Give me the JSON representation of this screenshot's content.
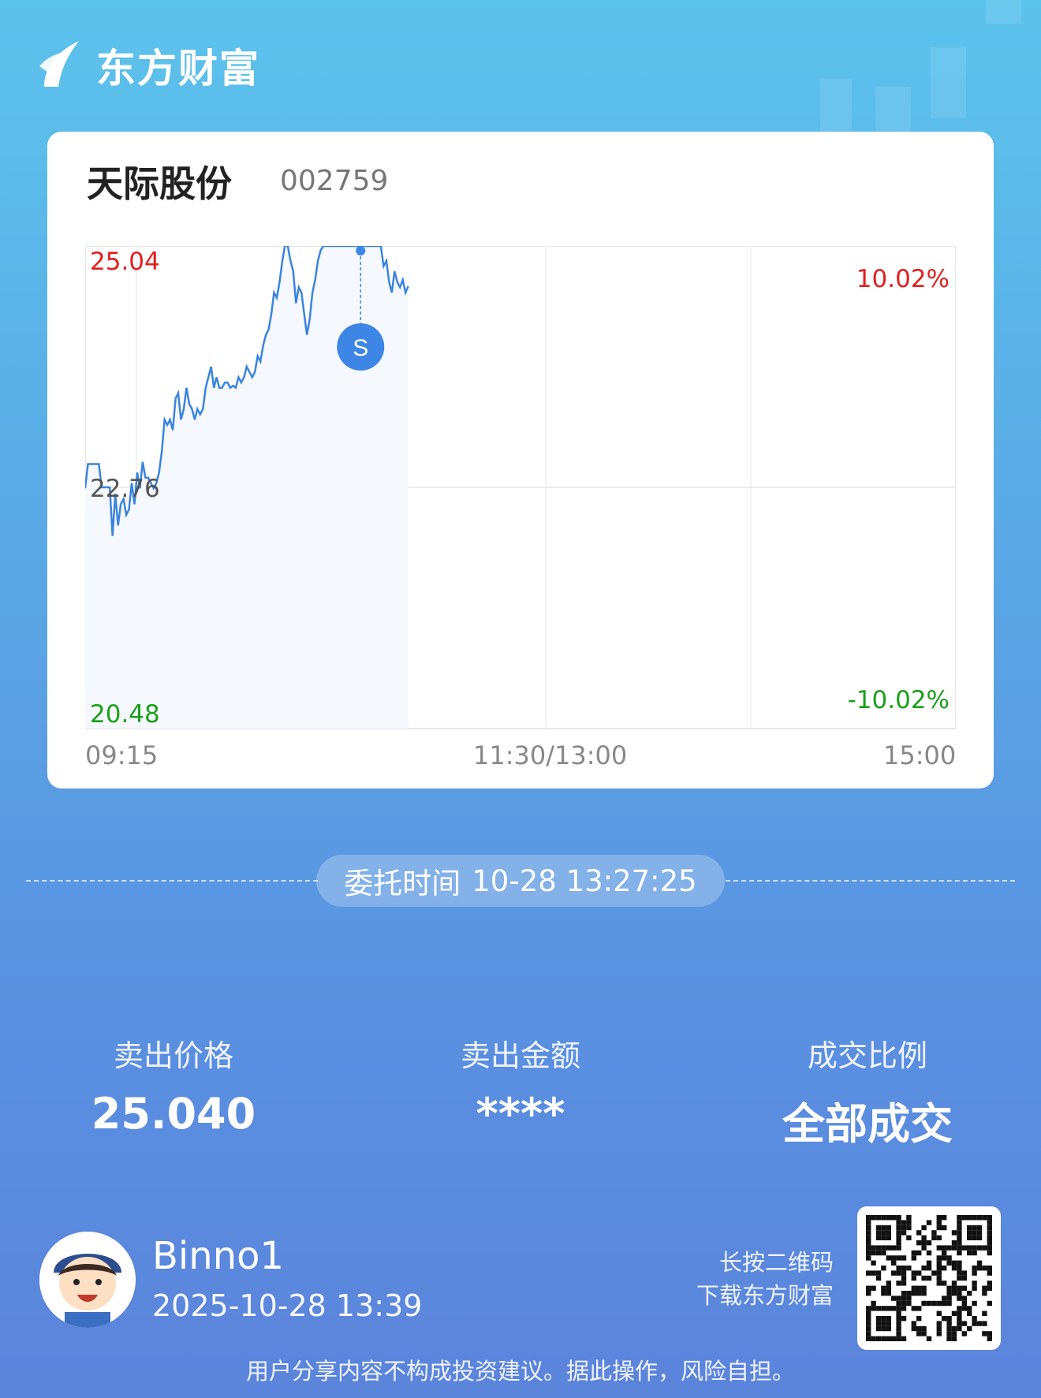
{
  "brand": {
    "name": "东方财富"
  },
  "stock": {
    "name": "天际股份",
    "code": "002759"
  },
  "chart_data": {
    "type": "line",
    "y_max_label": "25.04",
    "y_mid_label": "22.76",
    "y_min_label": "20.48",
    "pct_max_label": "10.02%",
    "pct_min_label": "-10.02%",
    "x_tick_labels": [
      "09:15",
      "11:30/13:00",
      "15:00"
    ],
    "ylim": [
      20.48,
      25.04
    ],
    "prev_close": 22.76,
    "marker": {
      "label": "S",
      "time_index": 186,
      "price": 25.04
    },
    "series": [
      {
        "values": [
          22.75,
          22.98,
          22.98,
          22.98,
          22.98,
          22.98,
          22.76,
          22.76,
          22.76,
          22.76,
          22.3,
          22.7,
          22.4,
          22.6,
          22.65,
          22.5,
          22.55,
          22.8,
          22.6,
          22.9,
          22.75,
          23.0,
          22.85,
          22.85,
          22.8,
          22.75,
          22.8,
          22.9,
          23.1,
          23.4,
          23.35,
          23.4,
          23.3,
          23.6,
          23.65,
          23.4,
          23.5,
          23.7,
          23.55,
          23.5,
          23.4,
          23.5,
          23.45,
          23.5,
          23.7,
          23.8,
          23.9,
          23.7,
          23.8,
          23.7,
          23.7,
          23.75,
          23.75,
          23.7,
          23.72,
          23.7,
          23.8,
          23.75,
          23.8,
          23.9,
          23.85,
          23.8,
          23.85,
          24.0,
          23.95,
          24.1,
          24.2,
          24.25,
          24.4,
          24.6,
          24.55,
          24.7,
          24.9,
          25.05,
          25.04,
          24.9,
          24.8,
          24.5,
          24.65,
          24.6,
          24.4,
          24.2,
          24.35,
          24.6,
          24.72,
          24.9,
          25.0,
          25.04,
          25.04,
          25.04,
          25.04,
          25.04,
          25.04,
          25.04,
          25.04,
          25.04,
          25.04,
          25.04,
          25.04,
          25.04,
          25.04,
          25.04,
          25.04,
          25.04,
          25.04,
          25.04,
          25.04,
          25.04,
          25.04,
          24.85,
          24.9,
          24.7,
          24.6,
          24.8,
          24.7,
          24.65,
          24.72,
          24.6,
          24.66
        ]
      }
    ]
  },
  "order": {
    "label": "委托时间",
    "time": "10-28 13:27:25"
  },
  "stats": [
    {
      "label": "卖出价格",
      "value": "25.040"
    },
    {
      "label": "卖出金额",
      "value": "****"
    },
    {
      "label": "成交比例",
      "value": "全部成交"
    }
  ],
  "user": {
    "name": "Binno1",
    "date": "2025-10-28 13:39"
  },
  "qr_hint": {
    "line1": "长按二维码",
    "line2": "下载东方财富"
  },
  "disclaimer": "用户分享内容不构成投资建议。据此操作，风险自担。",
  "colors": {
    "up": "#e02020",
    "down": "#1aa01a",
    "line": "#3b84df",
    "marker": "#3d86e6"
  }
}
